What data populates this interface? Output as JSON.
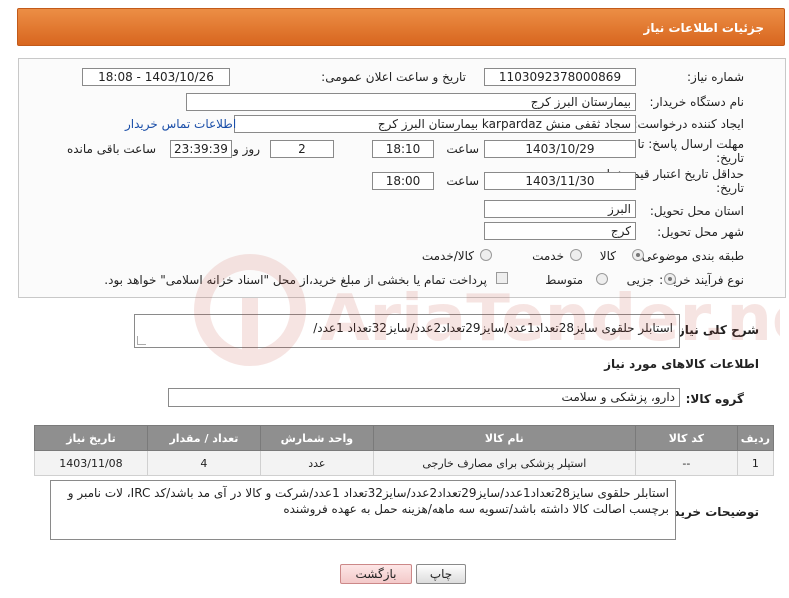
{
  "header": {
    "title": "جزئیات اطلاعات نیاز"
  },
  "form": {
    "need_number_label": "شماره نیاز:",
    "need_number": "1103092378000869",
    "announce_label": "تاریخ و ساعت اعلان عمومی:",
    "announce_value": "1403/10/26 - 18:08",
    "buyer_org_label": "نام دستگاه خریدار:",
    "buyer_org": "بیمارستان البرز کرج",
    "creator_label": "ایجاد کننده درخواست:",
    "creator": "سجاد ثقفی منش karpardaz بیمارستان البرز کرج",
    "contact_link": "اطلاعات تماس خریدار",
    "deadline_label_1": "مهلت ارسال پاسخ: تا",
    "deadline_label_2": "تاریخ:",
    "deadline_date": "1403/10/29",
    "time_label": "ساعت",
    "deadline_time": "18:10",
    "days_value": "2",
    "days_label": "روز و",
    "remaining_time": "23:39:39",
    "remaining_label": "ساعت باقی مانده",
    "min_price_label_1": "حداقل تاریخ اعتبار قیمت: تا",
    "min_price_label_2": "تاریخ:",
    "min_price_date": "1403/11/30",
    "min_price_time": "18:00",
    "province_label": "استان محل تحویل:",
    "province": "البرز",
    "city_label": "شهر محل تحویل:",
    "city": "کرج",
    "category_label": "طبقه بندی موضوعی:",
    "category_options": [
      "کالا",
      "خدمت",
      "کالا/خدمت"
    ],
    "category_selected": "کالا",
    "process_label": "نوع فرآیند خرید :",
    "process_options": [
      "جزیی",
      "متوسط"
    ],
    "process_selected": "جزیی",
    "payment_note": "پرداخت تمام یا بخشی از مبلغ خرید،از محل \"اسناد خزانه اسلامی\" خواهد بود."
  },
  "description": {
    "label": "شرح کلی نیاز:",
    "value": "استابلر حلقوی سایز28تعداد1عدد/سایز29تعداد2عدد/سایز32تعداد 1عدد/"
  },
  "goods_section": {
    "title": "اطلاعات کالاهای مورد نیاز",
    "group_label": "گروه کالا:",
    "group_value": "دارو، پزشکی و سلامت"
  },
  "table": {
    "headers": [
      "ردیف",
      "کد کالا",
      "نام کالا",
      "واحد شمارش",
      "تعداد / مقدار",
      "تاریخ نیاز"
    ],
    "rows": [
      [
        "1",
        "--",
        "استپلر پزشکی برای مصارف خارجی",
        "عدد",
        "4",
        "1403/11/08"
      ]
    ]
  },
  "buyer_notes": {
    "label": "توضیحات خریدار:",
    "value": "استابلر حلقوی سایز28تعداد1عدد/سایز29تعداد2عدد/سایز32تعداد 1عدد/شرکت و کالا در آی مد باشد/کد IRC، لات نامبر و برچسب اصالت کالا داشته باشد/تسویه سه ماهه/هزینه حمل به عهده فروشنده"
  },
  "buttons": {
    "print": "چاپ",
    "back": "بازگشت"
  },
  "watermark": {
    "text": "AriaTender.net",
    "color": "#c0392b"
  }
}
